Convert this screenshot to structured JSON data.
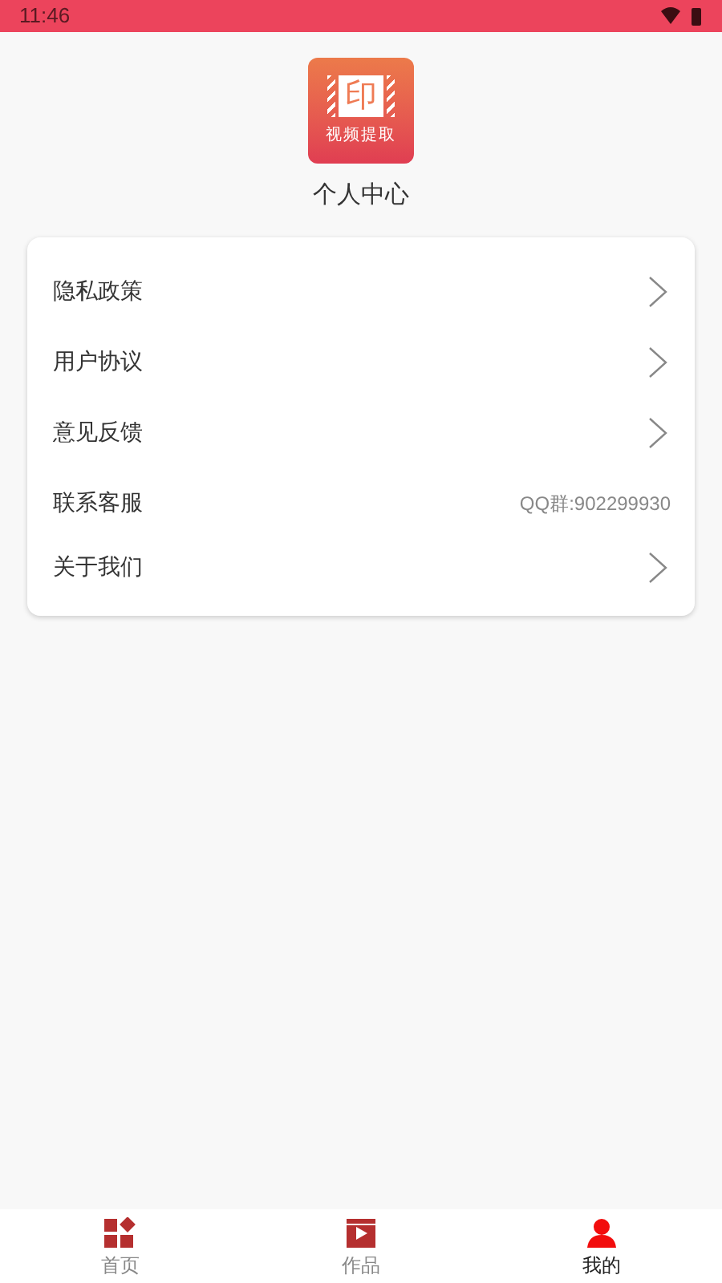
{
  "status_bar": {
    "time": "11:46"
  },
  "logo": {
    "glyph": "印",
    "caption": "视频提取"
  },
  "title": "个人中心",
  "menu": [
    {
      "label": "隐私政策",
      "kind": "link"
    },
    {
      "label": "用户协议",
      "kind": "link"
    },
    {
      "label": "意见反馈",
      "kind": "link"
    },
    {
      "label": "联系客服",
      "kind": "info",
      "value": "QQ群:902299930"
    },
    {
      "label": "关于我们",
      "kind": "link"
    }
  ],
  "tabs": [
    {
      "label": "首页",
      "kind": "home",
      "selected": false
    },
    {
      "label": "作品",
      "kind": "works",
      "selected": false
    },
    {
      "label": "我的",
      "kind": "mine",
      "selected": true
    }
  ]
}
